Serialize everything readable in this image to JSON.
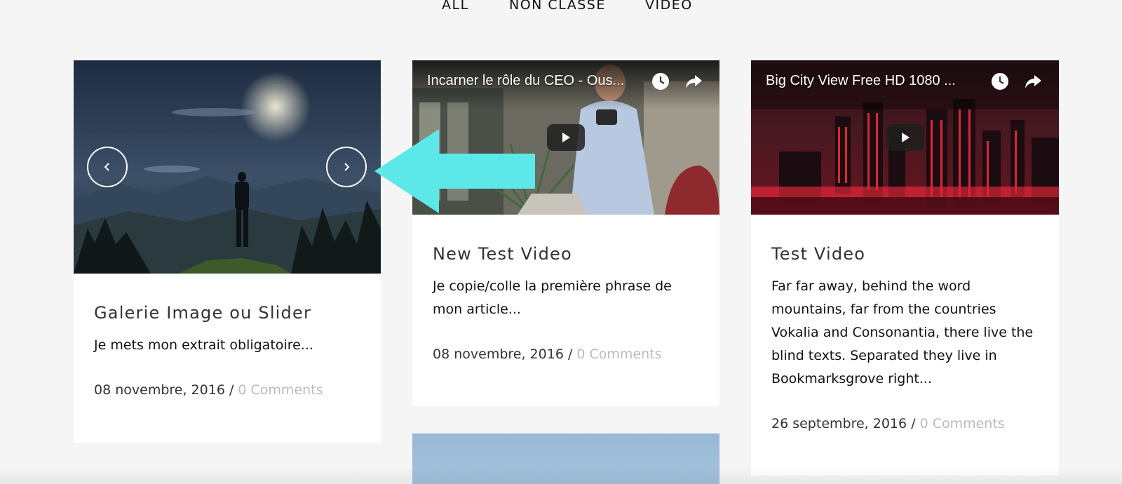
{
  "filters": [
    {
      "label": "ALL"
    },
    {
      "label": "NON CLASSÉ"
    },
    {
      "label": "VIDEO"
    }
  ],
  "posts": [
    {
      "title": "Galerie Image ou Slider",
      "excerpt": "Je mets mon extrait obligatoire...",
      "date": "08 novembre, 2016",
      "separator": " / ",
      "comments": "0 Comments"
    },
    {
      "video_title": "Incarner le rôle du CEO - Ous...",
      "title": "New Test Video",
      "excerpt": "Je copie/colle la première phrase de mon article...",
      "date": "08 novembre, 2016",
      "separator": " / ",
      "comments": "0 Comments"
    },
    {
      "video_title": "Big City View Free HD 1080 ...",
      "title": "Test Video",
      "excerpt": "Far far away, behind the word mountains, far from the countries Vokalia and Consonantia, there live the blind texts. Separated they live in Bookmarksgrove right...",
      "date": "26 septembre, 2016",
      "separator": " / ",
      "comments": "0 Comments"
    }
  ],
  "colors": {
    "background": "#f5f5f5",
    "card": "#ffffff",
    "comments": "#bbbbbb",
    "annotation_arrow": "#5ce8e8"
  },
  "icons": {
    "slider_prev": "chevron-left-icon",
    "slider_next": "chevron-right-icon",
    "watch_later": "clock-icon",
    "share": "share-arrow-icon",
    "play": "play-icon"
  }
}
